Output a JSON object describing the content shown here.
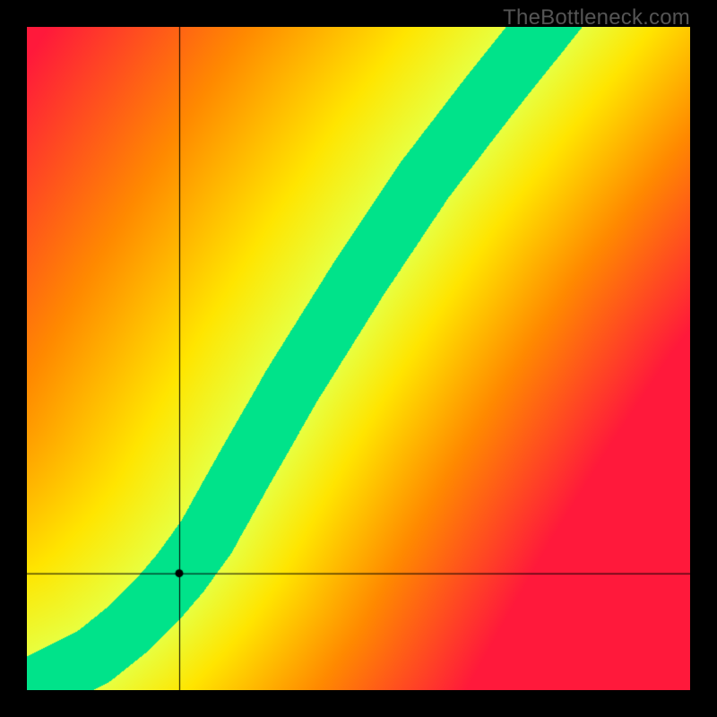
{
  "watermark": "TheBottleneck.com",
  "chart_data": {
    "type": "heatmap",
    "title": "",
    "xlabel": "",
    "ylabel": "",
    "xlim": [
      0,
      100
    ],
    "ylim": [
      0,
      100
    ],
    "marker": {
      "x": 23,
      "y": 17.5
    },
    "crosshair": {
      "x": 23,
      "y": 17.5
    },
    "optimal_curve": [
      {
        "x": 0,
        "y": 0
      },
      {
        "x": 10,
        "y": 5
      },
      {
        "x": 15,
        "y": 9
      },
      {
        "x": 20,
        "y": 14
      },
      {
        "x": 23,
        "y": 17.5
      },
      {
        "x": 27,
        "y": 23
      },
      {
        "x": 32,
        "y": 32
      },
      {
        "x": 40,
        "y": 46
      },
      {
        "x": 50,
        "y": 62
      },
      {
        "x": 60,
        "y": 77
      },
      {
        "x": 70,
        "y": 90
      },
      {
        "x": 78,
        "y": 100
      }
    ],
    "color_stops": [
      {
        "t": 0.0,
        "color": "#ff193b"
      },
      {
        "t": 0.4,
        "color": "#ff8a00"
      },
      {
        "t": 0.7,
        "color": "#ffe500"
      },
      {
        "t": 0.88,
        "color": "#e8ff40"
      },
      {
        "t": 1.0,
        "color": "#00e38a"
      }
    ],
    "band_half_width": 4.5,
    "falloff_scale": 55
  }
}
